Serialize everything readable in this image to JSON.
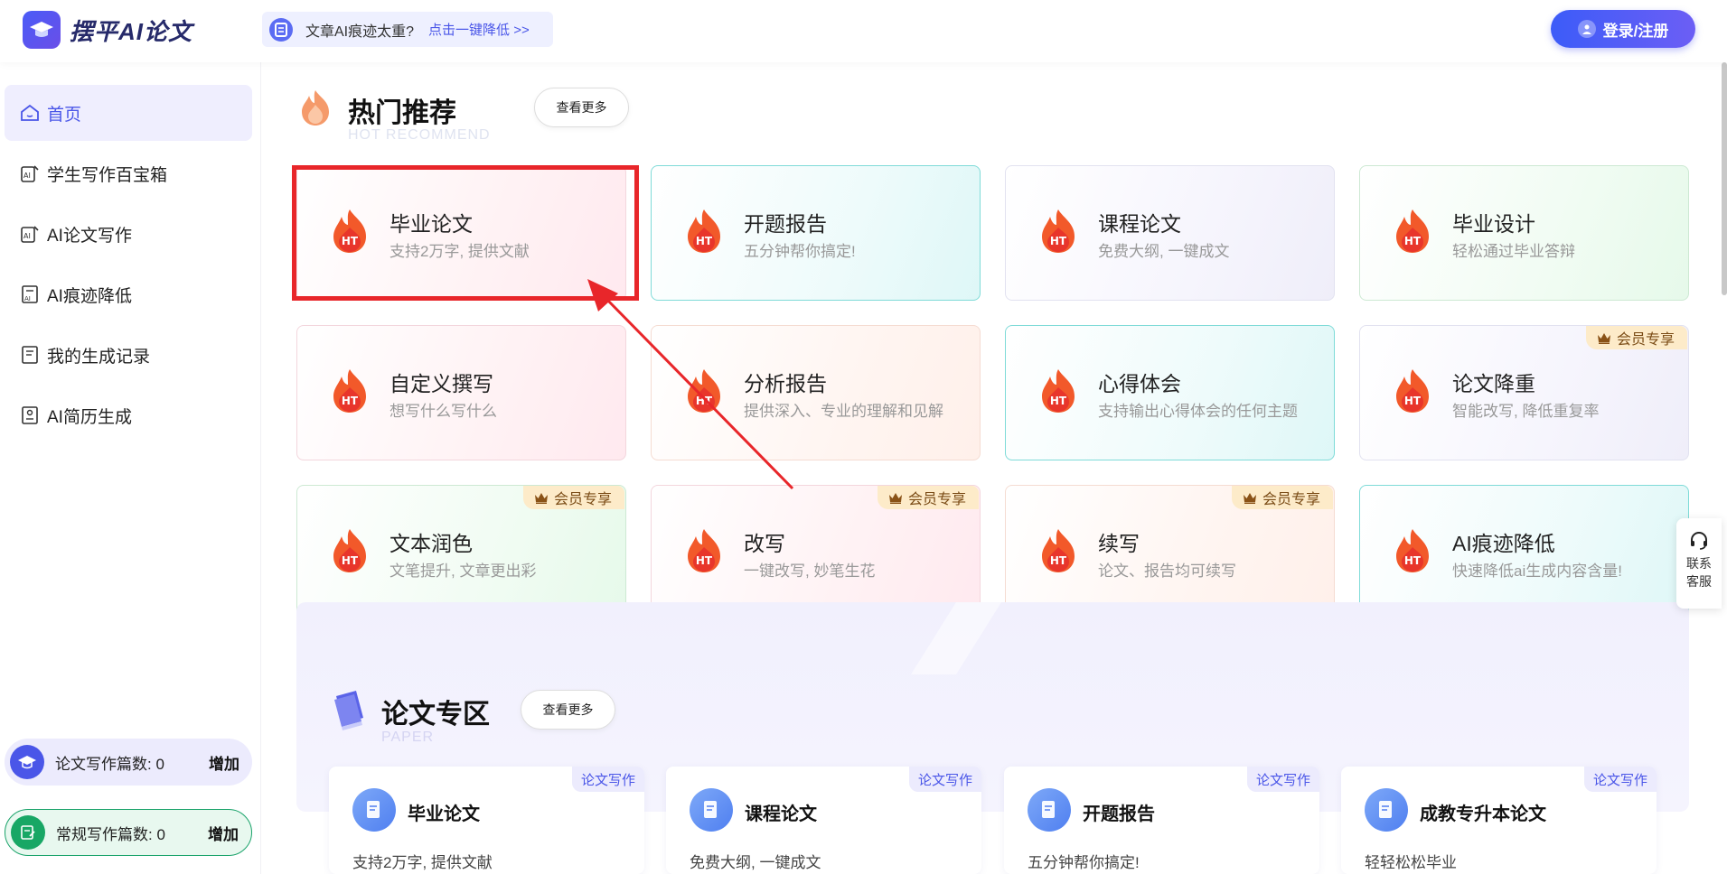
{
  "header": {
    "logo_text": "摆平AI论文",
    "notice_text": "文章AI痕迹太重?",
    "notice_link": "点击一键降低 >>",
    "login_label": "登录/注册"
  },
  "sidebar": {
    "items": [
      {
        "label": "首页",
        "icon": "home-icon"
      },
      {
        "label": "学生写作百宝箱",
        "icon": "ai-pen-icon"
      },
      {
        "label": "AI论文写作",
        "icon": "ai-pen-icon"
      },
      {
        "label": "AI痕迹降低",
        "icon": "ai-doc-icon"
      },
      {
        "label": "我的生成记录",
        "icon": "record-icon"
      },
      {
        "label": "AI简历生成",
        "icon": "resume-icon"
      }
    ],
    "counters": [
      {
        "label": "论文写作篇数: 0",
        "action": "增加"
      },
      {
        "label": "常规写作篇数: 0",
        "action": "增加"
      }
    ]
  },
  "hot": {
    "title": "热门推荐",
    "subtitle": "HOT RECOMMEND",
    "more": "查看更多",
    "cards": [
      {
        "title": "毕业论文",
        "desc": "支持2万字, 提供文献",
        "vip": ""
      },
      {
        "title": "开题报告",
        "desc": "五分钟帮你搞定!",
        "vip": ""
      },
      {
        "title": "课程论文",
        "desc": "免费大纲, 一键成文",
        "vip": ""
      },
      {
        "title": "毕业设计",
        "desc": "轻松通过毕业答辩",
        "vip": ""
      },
      {
        "title": "自定义撰写",
        "desc": "想写什么写什么",
        "vip": ""
      },
      {
        "title": "分析报告",
        "desc": "提供深入、专业的理解和见解",
        "vip": ""
      },
      {
        "title": "心得体会",
        "desc": "支持输出心得体会的任何主题",
        "vip": ""
      },
      {
        "title": "论文降重",
        "desc": "智能改写, 降低重复率",
        "vip": "会员专享"
      },
      {
        "title": "文本润色",
        "desc": "文笔提升, 文章更出彩",
        "vip": "会员专享"
      },
      {
        "title": "改写",
        "desc": "一键改写, 妙笔生花",
        "vip": "会员专享"
      },
      {
        "title": "续写",
        "desc": "论文、报告均可续写",
        "vip": "会员专享"
      },
      {
        "title": "AI痕迹降低",
        "desc": "快速降低ai生成内容含量!",
        "vip": ""
      }
    ],
    "flame_badge": "HT"
  },
  "paper": {
    "title": "论文专区",
    "subtitle": "PAPER",
    "more": "查看更多",
    "cards": [
      {
        "title": "毕业论文",
        "desc": "支持2万字, 提供文献",
        "tag": "论文写作"
      },
      {
        "title": "课程论文",
        "desc": "免费大纲, 一键成文",
        "tag": "论文写作"
      },
      {
        "title": "开题报告",
        "desc": "五分钟帮你搞定!",
        "tag": "论文写作"
      },
      {
        "title": "成教专升本论文",
        "desc": "轻轻松松毕业",
        "tag": "论文写作"
      }
    ]
  },
  "float": {
    "service_label": "联系客服"
  },
  "colors": {
    "accent": "#4a56e8",
    "highlight": "#e8262a",
    "vip_bg": "#fdebc9"
  }
}
